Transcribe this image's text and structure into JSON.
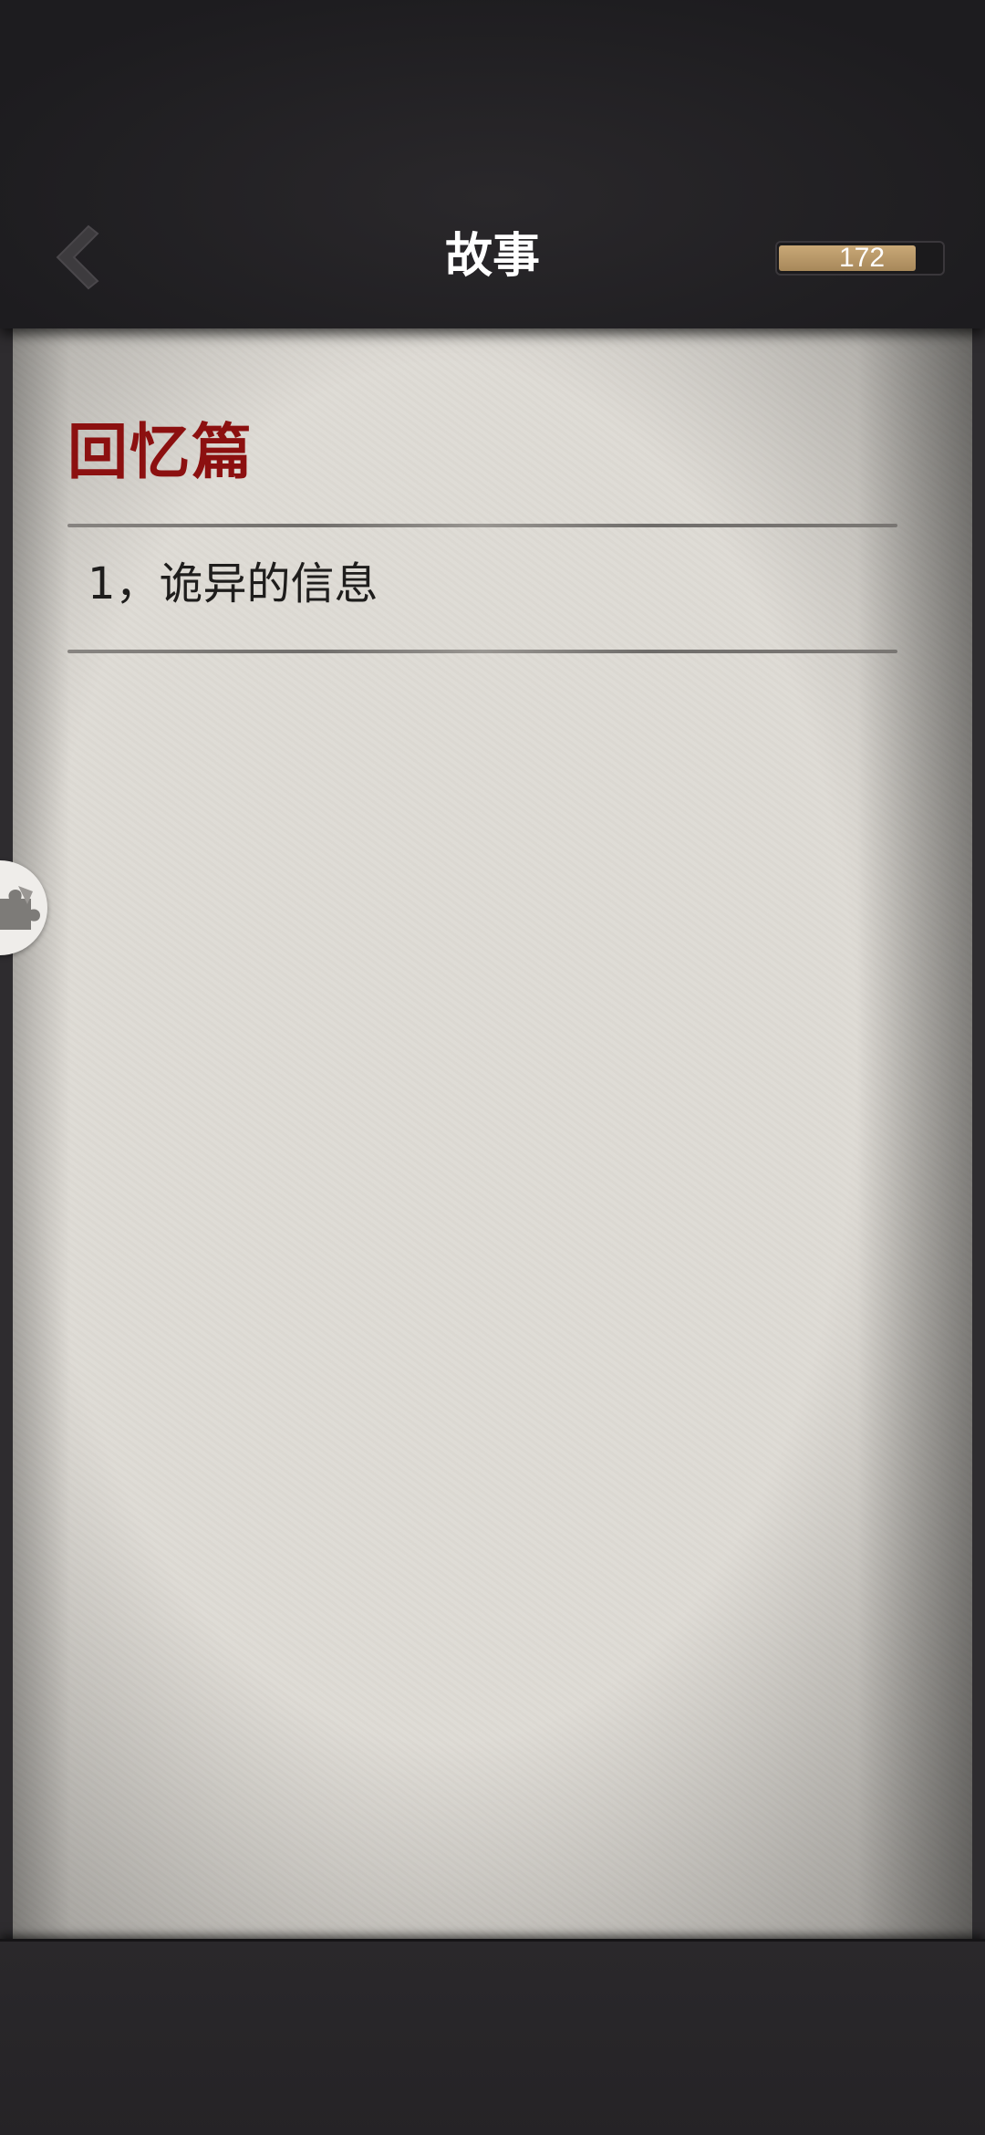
{
  "header": {
    "title": "故事",
    "counter_value": "172",
    "counter_fill_fraction": 0.84,
    "back_icon": "chevron-left-icon"
  },
  "story": {
    "section_title": "回忆篇",
    "items": [
      {
        "label": "1，诡异的信息"
      }
    ]
  },
  "side": {
    "puzzle_icon": "puzzle-piece-icon"
  },
  "colors": {
    "section_title": "#8c1010",
    "counter_fill": "#c9a877",
    "paper": "#dedbd5",
    "bar": "#222023"
  }
}
